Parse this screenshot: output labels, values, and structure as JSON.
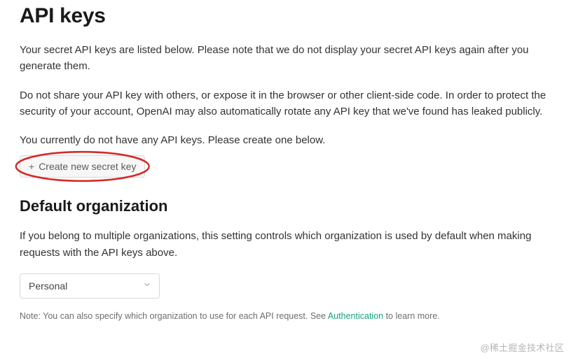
{
  "page_title": "API keys",
  "intro_paragraph": "Your secret API keys are listed below. Please note that we do not display your secret API keys again after you generate them.",
  "warning_paragraph": "Do not share your API key with others, or expose it in the browser or other client-side code. In order to protect the security of your account, OpenAI may also automatically rotate any API key that we've found has leaked publicly.",
  "empty_state": "You currently do not have any API keys. Please create one below.",
  "create_button_label": "Create new secret key",
  "default_org": {
    "heading": "Default organization",
    "description": "If you belong to multiple organizations, this setting controls which organization is used by default when making requests with the API keys above.",
    "selected": "Personal",
    "options": [
      "Personal"
    ]
  },
  "note": {
    "prefix": "Note: You can also specify which organization to use for each API request. See ",
    "link_text": "Authentication",
    "suffix": " to learn more."
  },
  "watermark": "@稀土掘金技术社区"
}
